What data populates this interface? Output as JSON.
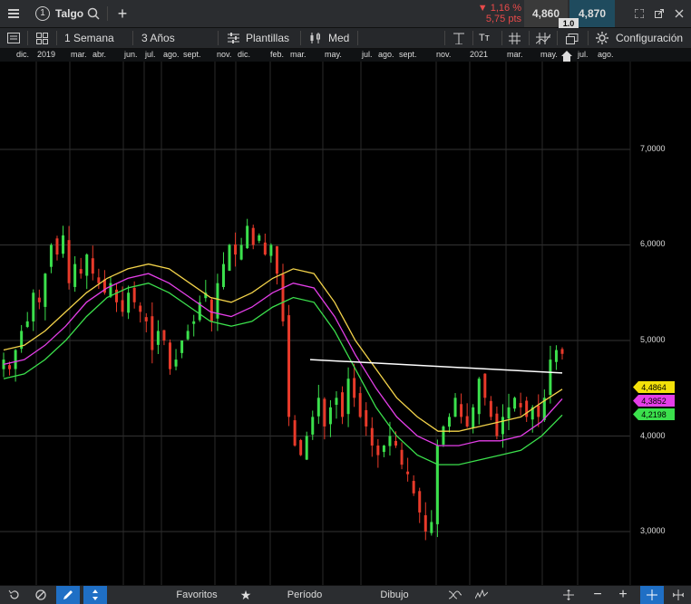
{
  "header": {
    "menu_icon": "hamburger-icon",
    "tab_number": "1",
    "instrument": "Talgo",
    "change_pct": "▼ 1,16 %",
    "change_pts": "5,75 pts",
    "sell_price": "4,860",
    "buy_price": "4,870",
    "spread": "1.0",
    "colors": {
      "down": "#e84a4a",
      "sell_bg": "#3a3a3a",
      "buy_bg": "#1f4b5e"
    }
  },
  "toolbar": {
    "interval": "1 Semana",
    "range": "3 Años",
    "templates": "Plantillas",
    "candle_type": "Med",
    "text_tool": "Tт",
    "settings": "Configuración"
  },
  "xaxis": {
    "labels": [
      "dic.",
      "2019",
      "mar.",
      "abr.",
      "jun.",
      "jul.",
      "ago.",
      "sept.",
      "nov.",
      "dic.",
      "feb.",
      "mar.",
      "may.",
      "jul.",
      "ago.",
      "sept.",
      "nov.",
      "2021",
      "mar.",
      "may.",
      "jul.",
      "ago."
    ]
  },
  "yaxis": {
    "labels": [
      "7,0000",
      "6,0000",
      "5,0000",
      "4,0000",
      "3,0000"
    ]
  },
  "badges": {
    "yellow": "4,4864",
    "magenta": "4,3852",
    "green": "4,2198"
  },
  "bottombar": {
    "favorites": "Favoritos",
    "period": "Período",
    "drawing": "Dibujo"
  },
  "chart_data": {
    "type": "candlestick",
    "ylim": [
      2.8,
      7.5
    ],
    "grid": true,
    "weekly_closes": [
      4.8,
      4.7,
      4.9,
      5.1,
      5.2,
      5.5,
      5.4,
      5.7,
      6.0,
      5.9,
      6.1,
      5.6,
      5.8,
      5.7,
      5.9,
      5.7,
      5.6,
      5.5,
      5.6,
      5.4,
      5.3,
      5.5,
      5.4,
      5.3,
      5.2,
      4.9,
      5.1,
      5.0,
      4.7,
      4.8,
      5.0,
      5.1,
      5.2,
      5.4,
      5.5,
      5.2,
      5.6,
      5.8,
      6.0,
      5.9,
      6.0,
      6.2,
      6.0,
      6.1,
      5.9,
      6.0,
      5.7,
      5.2,
      4.2,
      3.9,
      3.8,
      4.0,
      4.2,
      4.4,
      4.1,
      4.3,
      4.4,
      4.2,
      4.6,
      4.4,
      4.2,
      4.1,
      3.9,
      3.8,
      3.9,
      4.0,
      3.9,
      3.7,
      3.6,
      3.4,
      3.2,
      3.0,
      3.1,
      3.9,
      4.1,
      4.2,
      4.4,
      4.2,
      4.1,
      4.3,
      4.6,
      4.4,
      4.2,
      4.0,
      4.2,
      4.3,
      4.4,
      4.3,
      4.2,
      4.3,
      4.2,
      4.4,
      4.8,
      4.9,
      4.86
    ],
    "moving_averages": [
      {
        "color": "#f3d34a",
        "name": "",
        "values": [
          4.9,
          4.95,
          5.1,
          5.3,
          5.5,
          5.65,
          5.75,
          5.8,
          5.75,
          5.6,
          5.45,
          5.4,
          5.5,
          5.65,
          5.75,
          5.7,
          5.4,
          5.0,
          4.7,
          4.4,
          4.2,
          4.05,
          4.05,
          4.1,
          4.15,
          4.2,
          4.35,
          4.49
        ]
      },
      {
        "color": "#e43ee8",
        "name": "",
        "values": [
          4.75,
          4.8,
          4.95,
          5.15,
          5.4,
          5.55,
          5.65,
          5.7,
          5.6,
          5.45,
          5.3,
          5.25,
          5.35,
          5.5,
          5.6,
          5.55,
          5.25,
          4.85,
          4.5,
          4.2,
          4.0,
          3.9,
          3.9,
          3.95,
          3.95,
          4.0,
          4.15,
          4.39
        ]
      },
      {
        "color": "#3be04c",
        "name": "",
        "values": [
          4.6,
          4.65,
          4.8,
          5.0,
          5.25,
          5.45,
          5.55,
          5.6,
          5.5,
          5.35,
          5.2,
          5.15,
          5.2,
          5.35,
          5.45,
          5.4,
          5.1,
          4.7,
          4.3,
          4.0,
          3.8,
          3.7,
          3.7,
          3.75,
          3.8,
          3.85,
          4.0,
          4.22
        ]
      }
    ],
    "trendline": {
      "color": "#ffffff",
      "from": 4.8,
      "to": 4.66
    }
  }
}
